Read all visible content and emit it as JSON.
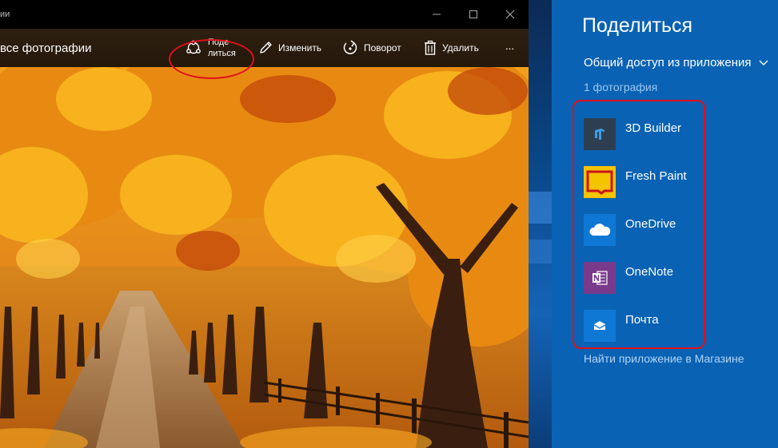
{
  "window": {
    "title": "ии",
    "back_label": "все фотографии",
    "controls": {
      "minimize": "minimize-icon",
      "maximize": "maximize-icon",
      "close": "close-icon"
    }
  },
  "toolbar": {
    "share_line1": "Поде-",
    "share_line2": "литься",
    "edit_label": "Изменить",
    "rotate_label": "Поворот",
    "delete_label": "Удалить",
    "more_label": "···"
  },
  "share_pane": {
    "title": "Поделиться",
    "dropdown_label": "Общий доступ из приложения",
    "count_label": "1 фотография",
    "apps": [
      {
        "label": "3D Builder",
        "icon": "3d-builder-icon",
        "color": "#2d3e50"
      },
      {
        "label": "Fresh Paint",
        "icon": "fresh-paint-icon",
        "color": "#f5c400"
      },
      {
        "label": "OneDrive",
        "icon": "onedrive-icon",
        "color": "#0f78d4"
      },
      {
        "label": "OneNote",
        "icon": "onenote-icon",
        "color": "#7a3a8c"
      },
      {
        "label": "Почта",
        "icon": "mail-icon",
        "color": "#0f78d4"
      }
    ],
    "store_link": "Найти приложение в Магазине"
  },
  "colors": {
    "pane_background": "#0a62b4",
    "highlight_red": "#e0101a",
    "toolbar_background": "#2b1d0e"
  }
}
